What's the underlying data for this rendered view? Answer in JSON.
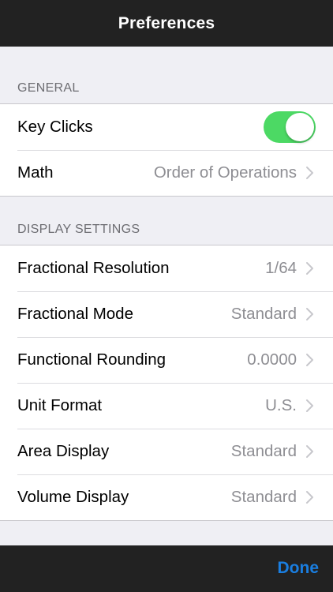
{
  "navbar": {
    "title": "Preferences"
  },
  "general": {
    "header": "GENERAL",
    "key_clicks": {
      "label": "Key Clicks",
      "enabled": true
    },
    "math": {
      "label": "Math",
      "value": "Order of Operations"
    }
  },
  "display": {
    "header": "DISPLAY SETTINGS",
    "rows": [
      {
        "label": "Fractional Resolution",
        "value": "1/64"
      },
      {
        "label": "Fractional Mode",
        "value": "Standard"
      },
      {
        "label": "Functional Rounding",
        "value": "0.0000"
      },
      {
        "label": "Unit Format",
        "value": "U.S."
      },
      {
        "label": "Area Display",
        "value": "Standard"
      },
      {
        "label": "Volume Display",
        "value": "Standard"
      }
    ]
  },
  "toolbar": {
    "done_label": "Done"
  },
  "colors": {
    "toggle_on": "#4cd964",
    "accent": "#1a7ee0",
    "bar": "#222222"
  },
  "icons": {
    "chevron": "chevron-right-icon"
  }
}
